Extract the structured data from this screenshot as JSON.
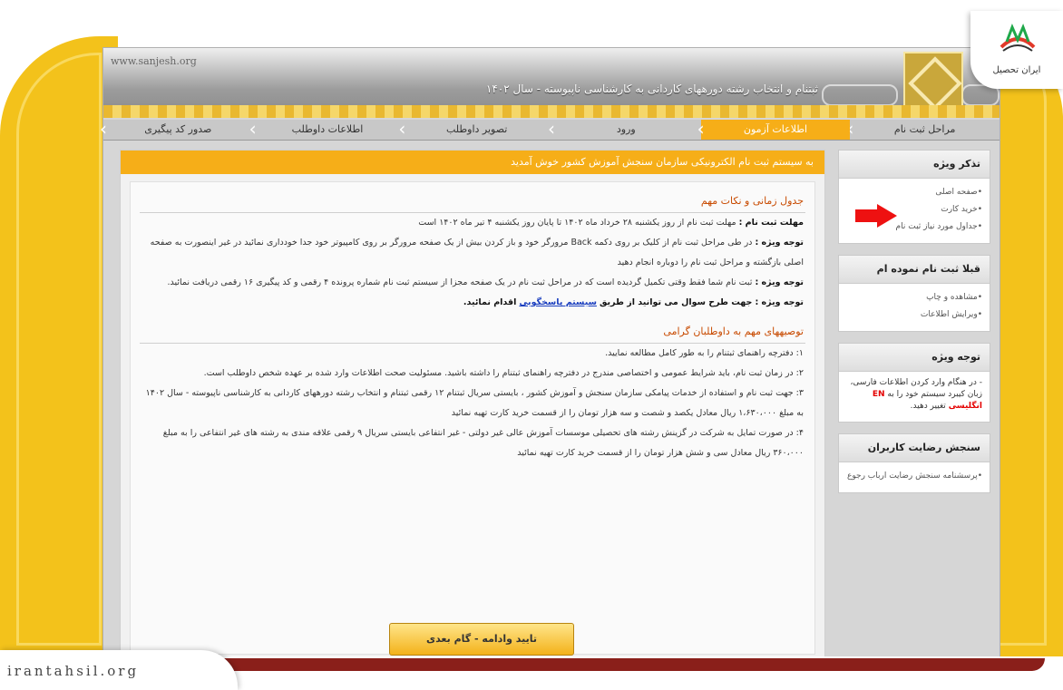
{
  "site": {
    "url": "www.sanjesh.org",
    "title": "ثبتنام و انتخاب رشته دورههای کاردانی به کارشناسی ناپیوسته - سال ۱۴۰۲"
  },
  "nav": {
    "items": [
      {
        "label": "مراحل ثبت نام"
      },
      {
        "label": "اطلاعات آزمون",
        "active": true
      },
      {
        "label": "ورود"
      },
      {
        "label": "تصویر داوطلب"
      },
      {
        "label": "اطلاعات داوطلب"
      },
      {
        "label": "صدور کد پیگیری"
      }
    ]
  },
  "main": {
    "welcome": "به سیستم ثبت نام الکترونیکی سازمان سنجش آموزش کشور خوش آمدید",
    "section1_title": "جدول زمانی و نکات مهم",
    "deadline_label": "مهلت ثبت نام :",
    "deadline_text": "مهلت ثبت نام از روز یکشنبه ۲۸ خرداد ماه ۱۴۰۲ تا پایان روز یکشنبه ۴ تیر ماه ۱۴۰۲ است",
    "note1_label": "توجه ویژه :",
    "note1_text": "در طی مراحل ثبت نام از کلیک بر روی دکمه Back مرورگر خود و باز کردن بیش از یک صفحه مرورگر بر روی کامپیوتر خود جدا خودداری نمائید در غیر اینصورت به صفحه اصلی بازگشته و مراحل ثبت نام را دوباره انجام دهید",
    "note2_label": "توجه ویژه :",
    "note2_text": "ثبت نام شما فقط وقتی تکمیل گردیده است که در مراحل ثبت نام در یک صفحه مجزا از سیستم ثبت نام شماره پرونده ۴ رقمی و کد پیگیری ۱۶ رقمی دریافت نمائید.",
    "note3_label": "توجه ویژه :",
    "note3_text_before": "جهت طرح سوال می توانید از طریق",
    "note3_link": "سیستم پاسخگویی",
    "note3_text_after": "اقدام نمائید.",
    "section2_title": "توصیههای مهم به داوطلبان گرامی",
    "rec1": "۱: دفترچه راهنمای ثبتنام را به طور کامل مطالعه نمایید.",
    "rec2": "۲: در زمان ثبت نام، باید شرایط عمومی و اختصاصی مندرج در دفترچه راهنمای ثبتنام را داشته باشید. مسئولیت صحت اطلاعات وارد شده بر عهده شخص داوطلب است.",
    "rec3": "۳: جهت ثبت نام و استفاده از خدمات پیامکی سازمان سنجش و آموزش کشور ، بایستی سریال ثبتنام ۱۲ رقمی ثبتنام و انتخاب رشته دورههای کاردانی به کارشناسی ناپیوسته - سال ۱۴۰۲ به مبلغ ۱،۶۳۰،۰۰۰ ریال معادل یکصد و شصت و سه هزار تومان را از قسمت خرید کارت تهیه نمائید",
    "rec4": "۴: در صورت تمایل به شرکت در گزینش رشته های تحصیلی موسسات آموزش عالی غیر دولتی - غیر انتفاعی بایستی سریال ۹ رقمی علاقه مندی به رشته های غیر انتفاعی را به مبلغ ۳۶۰،۰۰۰ ریال معادل سی و شش هزار تومان را از قسمت خرید کارت تهیه نمائید",
    "next_button": "تایید وادامه - گام بعدی"
  },
  "sidebar": {
    "box1_title": "تذکر ویژه",
    "box1_items": [
      "صفحه اصلی",
      "خرید کارت",
      "جداول مورد نیاز ثبت نام"
    ],
    "box2_title": "قبلا ثبت نام نموده ام",
    "box2_items": [
      "مشاهده و چاپ",
      "ویرایش اطلاعات"
    ],
    "box3_title": "توجه ویژه",
    "box3_text_before": "- در هنگام وارد کردن اطلاعات فارسی، زبان کیبرد سیستم خود را به",
    "box3_text_red": "EN انگلیسی",
    "box3_text_after": "تغییر دهید.",
    "box4_title": "سنجش رضایت کاربران",
    "box4_items": [
      "پرسشنامه سنجش رضایت ارباب رجوع"
    ]
  },
  "brand": {
    "name": "ایران تحصیل",
    "watermark": "irantahsil.org"
  },
  "colors": {
    "gold": "#f3c21b",
    "nav_active": "#f6ae18",
    "red_note": "#e40000",
    "link": "#1b3fbf"
  }
}
